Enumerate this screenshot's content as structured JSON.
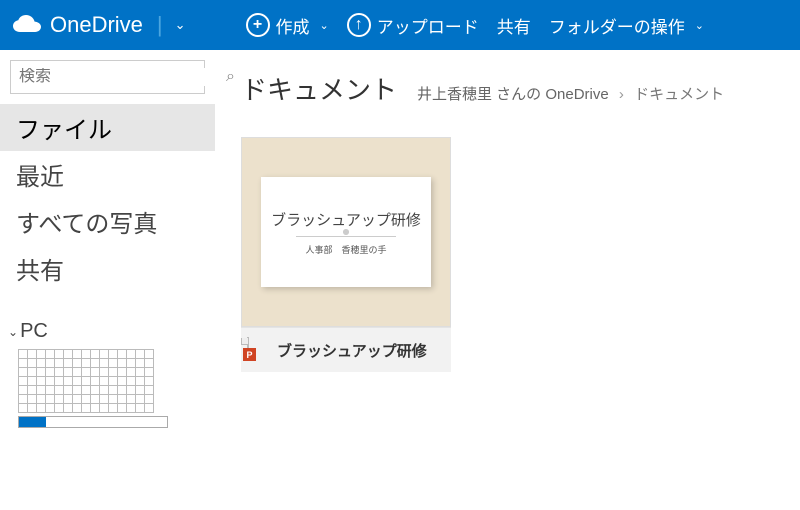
{
  "brand": {
    "name": "OneDrive"
  },
  "toolbar": {
    "create": "作成",
    "upload": "アップロード",
    "share": "共有",
    "folder_ops": "フォルダーの操作"
  },
  "search": {
    "placeholder": "検索"
  },
  "nav": {
    "files": "ファイル",
    "recent": "最近",
    "all_photos": "すべての写真",
    "shared": "共有"
  },
  "pc_section": {
    "label": "PC"
  },
  "page": {
    "title": "ドキュメント",
    "breadcrumb_owner": "井上香穂里 さんの OneDrive",
    "breadcrumb_current": "ドキュメント"
  },
  "files": [
    {
      "name": "ブラッシュアップ研修",
      "slide_title": "ブラッシュアップ研修",
      "slide_sub": "人事部　香穂里の手",
      "type": "powerpoint"
    }
  ]
}
